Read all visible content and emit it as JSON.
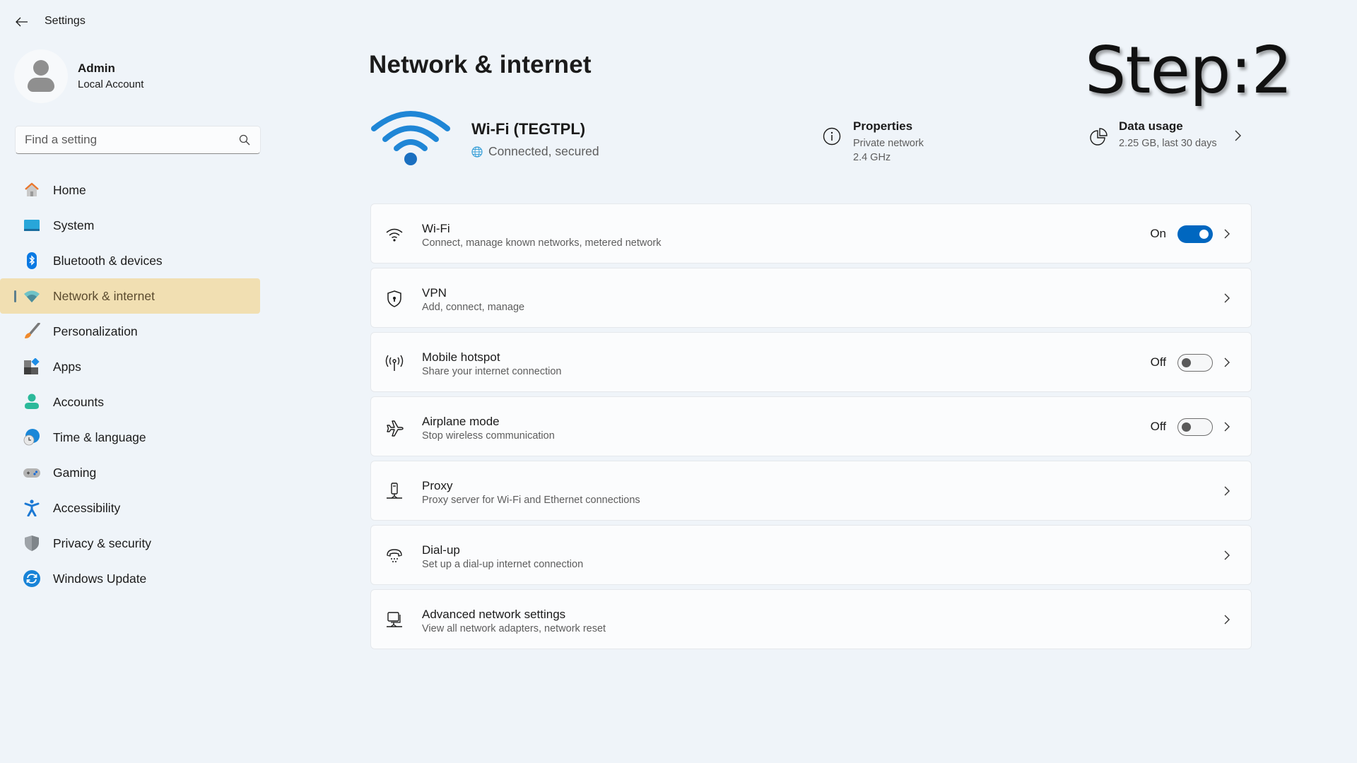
{
  "window": {
    "app_title": "Settings",
    "back_icon": "arrow-left-icon"
  },
  "profile": {
    "name": "Admin",
    "account_type": "Local Account",
    "avatar_icon": "person-icon"
  },
  "search": {
    "placeholder": "Find a setting",
    "value": "",
    "icon": "search-icon"
  },
  "sidebar": {
    "selected": "Network & internet",
    "items": [
      {
        "label": "Home",
        "icon": "home-icon"
      },
      {
        "label": "System",
        "icon": "monitor-icon"
      },
      {
        "label": "Bluetooth & devices",
        "icon": "bluetooth-icon"
      },
      {
        "label": "Network & internet",
        "icon": "wifi-icon"
      },
      {
        "label": "Personalization",
        "icon": "paintbrush-icon"
      },
      {
        "label": "Apps",
        "icon": "apps-icon"
      },
      {
        "label": "Accounts",
        "icon": "account-icon"
      },
      {
        "label": "Time & language",
        "icon": "globe-clock-icon"
      },
      {
        "label": "Gaming",
        "icon": "gamepad-icon"
      },
      {
        "label": "Accessibility",
        "icon": "accessibility-icon"
      },
      {
        "label": "Privacy & security",
        "icon": "shield-icon"
      },
      {
        "label": "Windows Update",
        "icon": "sync-icon"
      }
    ]
  },
  "main": {
    "page_title": "Network & internet",
    "annotation": "Step:2",
    "connection": {
      "name": "Wi-Fi (TEGTPL)",
      "status": "Connected, secured",
      "icon": "wifi-large-icon"
    },
    "properties": {
      "title": "Properties",
      "network_type": "Private network",
      "band": "2.4 GHz",
      "icon": "info-icon"
    },
    "data_usage": {
      "title": "Data usage",
      "value": "2.25 GB, last 30 days",
      "icon": "pie-chart-icon"
    },
    "cards": [
      {
        "title": "Wi-Fi",
        "subtitle": "Connect, manage known networks, metered network",
        "icon": "wifi-icon",
        "toggle": true,
        "state": "On"
      },
      {
        "title": "VPN",
        "subtitle": "Add, connect, manage",
        "icon": "vpn-shield-icon",
        "toggle": null,
        "state": ""
      },
      {
        "title": "Mobile hotspot",
        "subtitle": "Share your internet connection",
        "icon": "hotspot-icon",
        "toggle": false,
        "state": "Off"
      },
      {
        "title": "Airplane mode",
        "subtitle": "Stop wireless communication",
        "icon": "airplane-icon",
        "toggle": false,
        "state": "Off"
      },
      {
        "title": "Proxy",
        "subtitle": "Proxy server for Wi-Fi and Ethernet connections",
        "icon": "proxy-icon",
        "toggle": null,
        "state": ""
      },
      {
        "title": "Dial-up",
        "subtitle": "Set up a dial-up internet connection",
        "icon": "dialup-icon",
        "toggle": null,
        "state": ""
      },
      {
        "title": "Advanced network settings",
        "subtitle": "View all network adapters, network reset",
        "icon": "network-adapter-icon",
        "toggle": null,
        "state": ""
      }
    ]
  },
  "colors": {
    "accent": "#0067c0",
    "selected_nav_bg": "#f1dfb2",
    "background": "#eff4f9",
    "card_bg": "#fbfcfd"
  }
}
